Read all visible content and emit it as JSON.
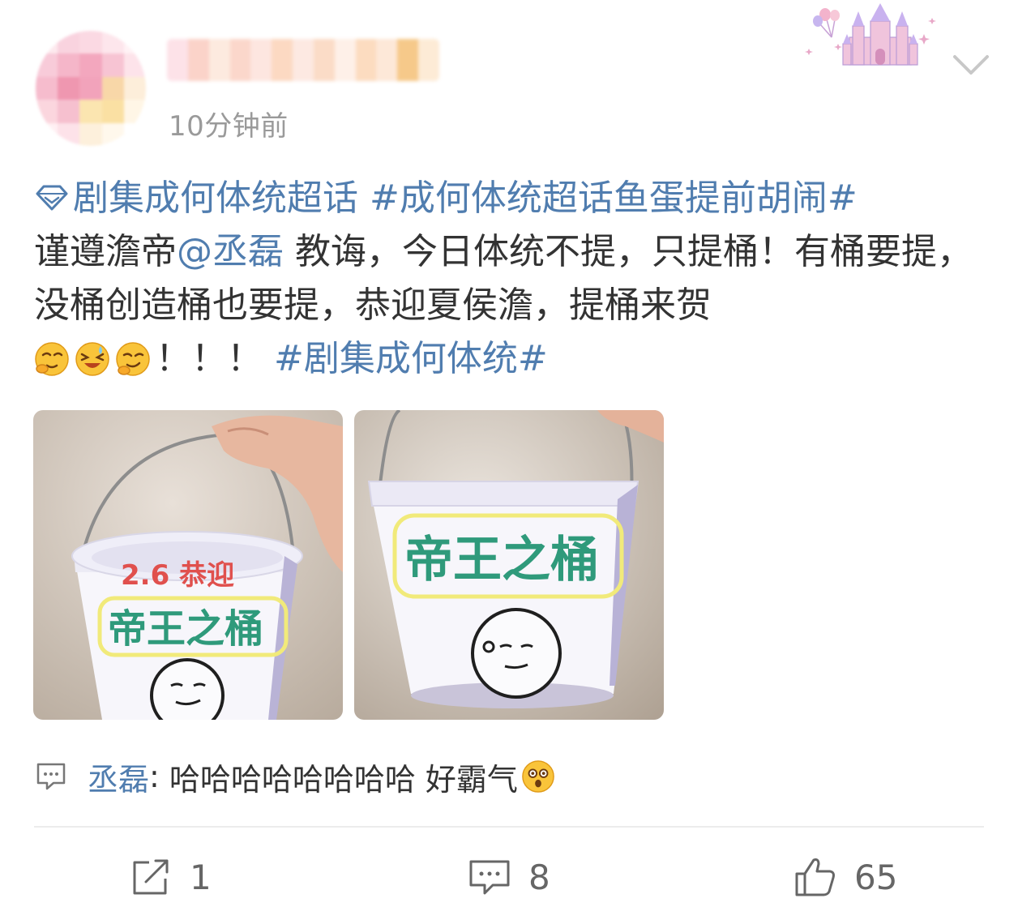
{
  "post": {
    "time": "10分钟前",
    "text": {
      "supertopic": "剧集成何体统超话",
      "hashtag1": "#成何体统超话鱼蛋提前胡闹#",
      "line_prefix": "谨遵澹帝",
      "mention": "@丞磊",
      "line_suffix": " 教诲，今日体统不提，只提桶！有桶要提，没桶创造桶也要提，恭迎夏侯澹，提桶来贺",
      "after_emoji": "！！！",
      "hashtag2": "#剧集成何体统#"
    },
    "photos": [
      {
        "caption_red": "2.6 恭迎",
        "caption_green": "帝王之桶"
      },
      {
        "caption_green": "帝王之桶"
      }
    ],
    "comment_preview": {
      "author": "丞磊",
      "separator": ":",
      "text": " 哈哈哈哈哈哈哈哈 好霸气"
    }
  },
  "actions": {
    "repost_count": "1",
    "comment_count": "8",
    "like_count": "65"
  },
  "colors": {
    "link": "#507daf",
    "text": "#333333",
    "meta": "#9a9a9a",
    "icon": "#666666"
  },
  "icons": [
    "supertopic-diamond-icon",
    "emoji-thinking-icon",
    "emoji-laughing-icon",
    "emoji-smirk-icon",
    "emoji-surprised-icon",
    "comment-preview-icon",
    "repost-icon",
    "comment-icon",
    "like-icon",
    "chevron-down-icon",
    "castle-badge-icon"
  ]
}
